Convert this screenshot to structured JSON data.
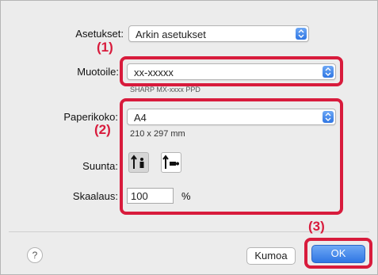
{
  "settings": {
    "label": "Asetukset:",
    "value": "Arkin asetukset"
  },
  "format_for": {
    "label": "Muotoile:",
    "value": "xx-xxxxx",
    "sub": "SHARP MX-xxxx PPD"
  },
  "paper_size": {
    "label": "Paperikoko:",
    "value": "A4",
    "dimensions": "210 x 297 mm"
  },
  "orientation": {
    "label": "Suunta:",
    "selected": "portrait"
  },
  "scale": {
    "label": "Skaalaus:",
    "value": "100",
    "unit": "%"
  },
  "callouts": {
    "one": "(1)",
    "two": "(2)",
    "three": "(3)"
  },
  "buttons": {
    "help": "?",
    "cancel": "Kumoa",
    "ok": "OK"
  },
  "colors": {
    "callout": "#d81b3c",
    "accent": "#2f76e3"
  }
}
